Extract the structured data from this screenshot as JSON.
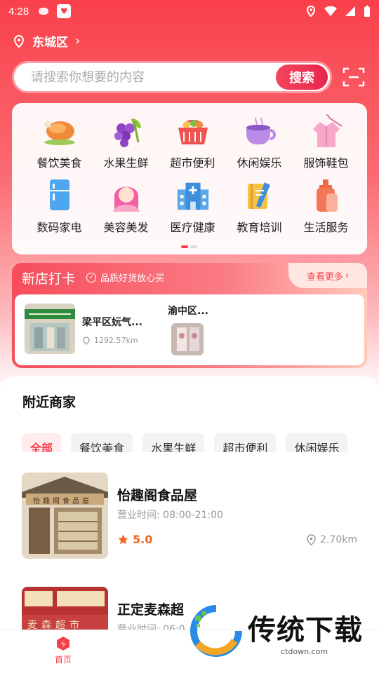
{
  "status_bar": {
    "time": "4:28"
  },
  "location": {
    "district": "东城区"
  },
  "search": {
    "placeholder": "请搜索你想要的内容",
    "button_label": "搜索"
  },
  "categories": [
    {
      "label": "餐饮美食",
      "icon": "roast-chicken-icon"
    },
    {
      "label": "水果生鲜",
      "icon": "grapes-icon"
    },
    {
      "label": "超市便利",
      "icon": "shopping-basket-icon"
    },
    {
      "label": "休闲娱乐",
      "icon": "coffee-cup-icon"
    },
    {
      "label": "服饰鞋包",
      "icon": "clothing-icon"
    },
    {
      "label": "数码家电",
      "icon": "refrigerator-icon"
    },
    {
      "label": "美容美发",
      "icon": "beauty-face-icon"
    },
    {
      "label": "医疗健康",
      "icon": "hospital-icon"
    },
    {
      "label": "教育培训",
      "icon": "book-pencil-icon"
    },
    {
      "label": "生活服务",
      "icon": "lotion-bottle-icon"
    }
  ],
  "new_shops": {
    "title": "新店打卡",
    "tagline": "品质好货放心买",
    "more_label": "查看更多",
    "shops": [
      {
        "name": "梁平区妧气...",
        "distance": "1292.57km"
      },
      {
        "name": "渝中区..."
      }
    ]
  },
  "nearby": {
    "heading": "附近商家",
    "filters": [
      "全部",
      "餐饮美食",
      "水果生鲜",
      "超市便利",
      "休闲娱乐"
    ],
    "active_filter": "全部",
    "merchants": [
      {
        "name": "怡趣阁食品屋",
        "hours": "营业时间: 08:00-21:00",
        "rating": "5.0",
        "distance": "2.70km",
        "sign_text": "怡趣阁食品屋"
      },
      {
        "name": "正定麦森超",
        "hours": "营业时间: 06:0",
        "sign_text": "麦森超市"
      }
    ]
  },
  "tabbar": {
    "home_label": "首页"
  },
  "watermark": {
    "text": "传统下载",
    "sub": "ctdown.com"
  },
  "colors": {
    "brand": "#f5404b",
    "rating": "#f0641e"
  }
}
